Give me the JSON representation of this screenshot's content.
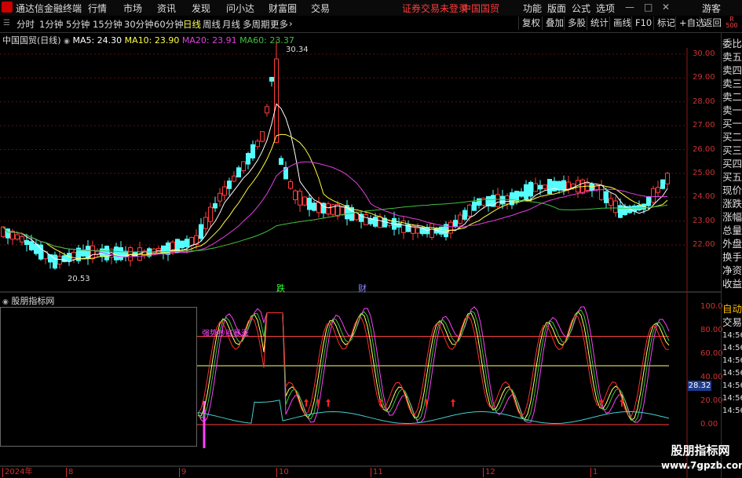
{
  "menubar": {
    "app_title": "通达信金融终端",
    "items": [
      "行情",
      "市场",
      "资讯",
      "发现",
      "问小达",
      "财富圈",
      "交易"
    ],
    "login_notice": "证券交易未登录",
    "stock_name": "中国国贸",
    "right_items": [
      "功能",
      "版面",
      "公式",
      "选项"
    ],
    "guest": "游客"
  },
  "toolbar": {
    "periods": [
      "分时",
      "1分钟",
      "5分钟",
      "15分钟",
      "30分钟",
      "60分钟",
      "日线",
      "周线",
      "月线",
      "多周期",
      "更多"
    ],
    "active_period": "日线",
    "right_buttons": [
      "复权",
      "叠加",
      "多股",
      "统计",
      "画线",
      "F10",
      "标记",
      "+自选",
      "返回"
    ]
  },
  "main_chart": {
    "title": "中国国贸(日线)",
    "ma5": "MA5: 24.30",
    "ma10": "MA10: 23.90",
    "ma20": "MA20: 23.91",
    "ma60": "MA60: 23.37",
    "high_label": "30.34",
    "low_label": "20.53",
    "y_ticks": [
      "30.00",
      "29.00",
      "28.00",
      "27.00",
      "26.00",
      "25.00",
      "24.00",
      "23.00",
      "22.00"
    ],
    "markers": [
      "跌",
      "财"
    ],
    "colors": {
      "up": "#ff3b3b",
      "down": "#5ff",
      "ma5": "#ffffff",
      "ma10": "#ffff40",
      "ma20": "#e040e0",
      "ma60": "#40c040"
    }
  },
  "indicator": {
    "title": "股朋指标网",
    "annotation": "强势抄底暴涨",
    "y_ticks": [
      "100.0",
      "80.00",
      "60.00",
      "40.00",
      "20.00",
      "0.00"
    ],
    "current_value": "28.32"
  },
  "x_axis": {
    "labels": [
      "2024年",
      "8",
      "9",
      "10",
      "11",
      "12",
      "1"
    ]
  },
  "right_panel": {
    "corner": "R 500",
    "labels": [
      "委比",
      "卖五",
      "卖四",
      "卖三",
      "卖二",
      "卖一",
      "买一",
      "买二",
      "买三",
      "买四",
      "买五",
      "现价",
      "涨跌",
      "涨幅",
      "总量",
      "外盘",
      "换手",
      "净资",
      "收益"
    ],
    "lower_labels": [
      "自动",
      "交易"
    ],
    "times": [
      "14:56",
      "14:56",
      "14:56",
      "14:56",
      "14:56",
      "14:56",
      "14:56"
    ]
  },
  "watermark": {
    "line1": "股朋指标网",
    "line2": "www.7gpzb.com"
  }
}
